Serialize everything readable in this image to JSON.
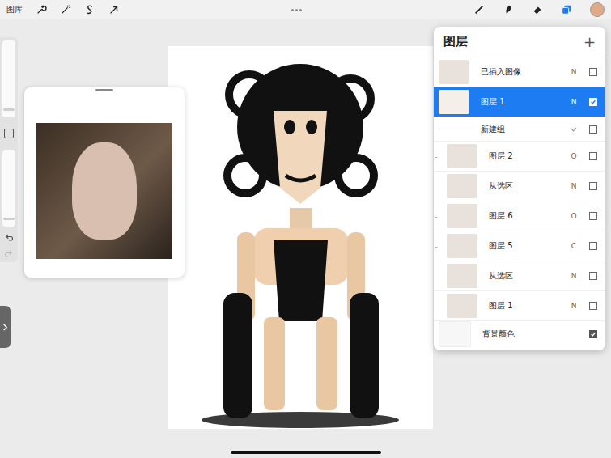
{
  "toolbar": {
    "gallery": "图库"
  },
  "layers_panel": {
    "title": "图层",
    "add": "+",
    "layers": [
      {
        "name": "已插入图像",
        "kind": "layer",
        "mode": "N",
        "visible": false,
        "selected": false,
        "clipped": false,
        "in_group": false
      },
      {
        "name": "图层 1",
        "kind": "layer",
        "mode": "N",
        "visible": true,
        "selected": true,
        "clipped": false,
        "in_group": false
      },
      {
        "name": "新建组",
        "kind": "group",
        "expanded": true,
        "visible": false,
        "selected": false,
        "clipped": false,
        "in_group": false
      },
      {
        "name": "图层 2",
        "kind": "layer",
        "mode": "O",
        "visible": false,
        "selected": false,
        "clipped": true,
        "in_group": true
      },
      {
        "name": "从选区",
        "kind": "layer",
        "mode": "N",
        "visible": false,
        "selected": false,
        "clipped": false,
        "in_group": true
      },
      {
        "name": "图层 6",
        "kind": "layer",
        "mode": "O",
        "visible": false,
        "selected": false,
        "clipped": true,
        "in_group": true
      },
      {
        "name": "图层 5",
        "kind": "layer",
        "mode": "C",
        "visible": false,
        "selected": false,
        "clipped": true,
        "in_group": true
      },
      {
        "name": "从选区",
        "kind": "layer",
        "mode": "N",
        "visible": false,
        "selected": false,
        "clipped": false,
        "in_group": true
      },
      {
        "name": "图层 1",
        "kind": "layer",
        "mode": "N",
        "visible": false,
        "selected": false,
        "clipped": false,
        "in_group": true
      },
      {
        "name": "背景颜色",
        "kind": "background",
        "visible": true,
        "selected": false,
        "clipped": false,
        "in_group": false
      }
    ]
  }
}
